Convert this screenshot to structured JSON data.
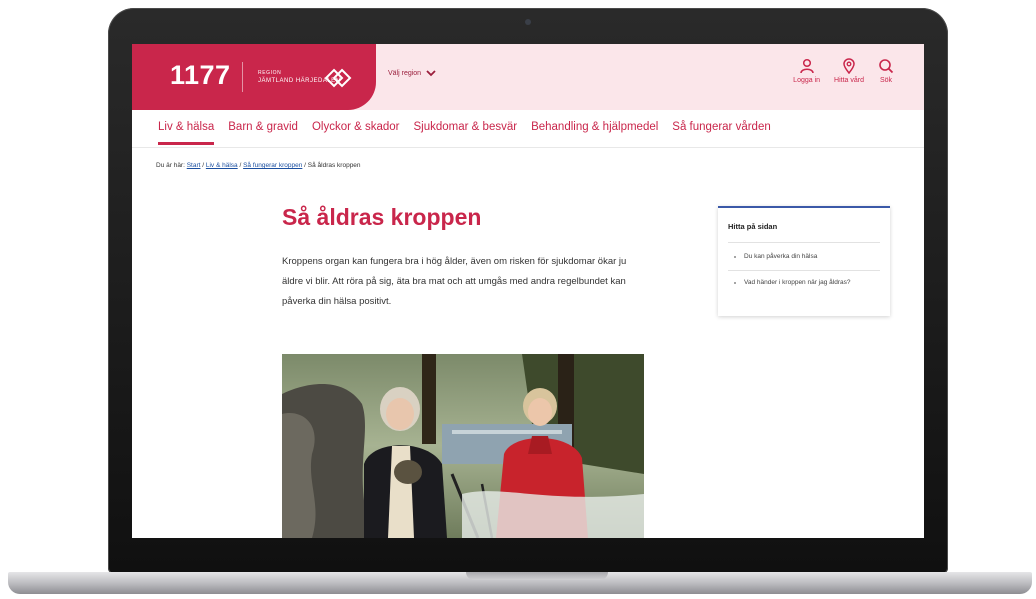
{
  "brand": {
    "logo": "1177",
    "partner_line1": "REGION",
    "partner_line2": "JÄMTLAND HÄRJEDALEN",
    "primary_color": "#c9264b"
  },
  "header": {
    "region_select": "Välj region",
    "actions": [
      {
        "label": "Logga in",
        "icon": "user-icon"
      },
      {
        "label": "Hitta vård",
        "icon": "location-pin-icon"
      },
      {
        "label": "Sök",
        "icon": "search-icon"
      }
    ]
  },
  "nav": {
    "items": [
      {
        "label": "Liv & hälsa",
        "active": true
      },
      {
        "label": "Barn & gravid"
      },
      {
        "label": "Olyckor & skador"
      },
      {
        "label": "Sjukdomar & besvär"
      },
      {
        "label": "Behandling & hjälpmedel"
      },
      {
        "label": "Så fungerar vården"
      }
    ]
  },
  "breadcrumb": {
    "prefix": "Du är här:",
    "links": [
      "Start",
      "Liv & hälsa",
      "Så fungerar kroppen"
    ],
    "current": "Så åldras kroppen",
    "separator": " / "
  },
  "article": {
    "title": "Så åldras kroppen",
    "lead": "Kroppens organ kan fungera bra i hög ålder, även om risken för sjukdomar ökar ju äldre vi blir. Att röra på sig, äta bra mat och att umgås med andra regelbundet kan påverka din hälsa positivt."
  },
  "toc": {
    "title": "Hitta på sidan",
    "items": [
      "Du kan påverka din hälsa",
      "Vad händer i kroppen när jag åldras?"
    ]
  }
}
